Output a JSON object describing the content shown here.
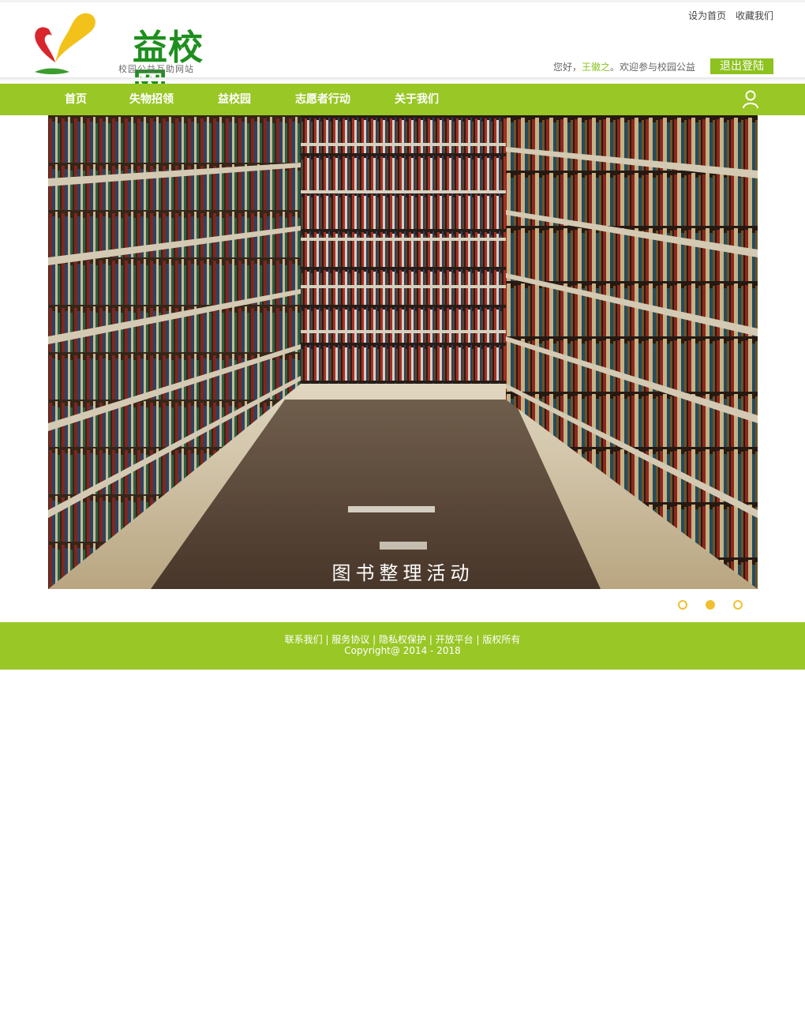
{
  "header": {
    "logo_text": "益校网",
    "logo_subtitle": "校园公益互助网站",
    "top_links": [
      "设为首页",
      "收藏我们"
    ],
    "greeting_prefix": "您好，",
    "username": "王徽之",
    "greeting_suffix": "。欢迎参与校园公益",
    "logout_label": "退出登陆"
  },
  "nav": {
    "items": [
      "首页",
      "失物招领",
      "益校园",
      "志愿者行动",
      "关于我们"
    ]
  },
  "banner": {
    "caption": "图书整理活动",
    "slides": 3,
    "active_slide": 2
  },
  "footer": {
    "links": [
      "联系我们",
      "服务协议",
      "隐私权保护",
      "开放平台",
      "版权所有"
    ],
    "copyright": "Copyright@ 2014 - 2018"
  },
  "colors": {
    "brand_green": "#99c726",
    "logo_green": "#1e8f1e",
    "dot_yellow": "#f0c030"
  }
}
